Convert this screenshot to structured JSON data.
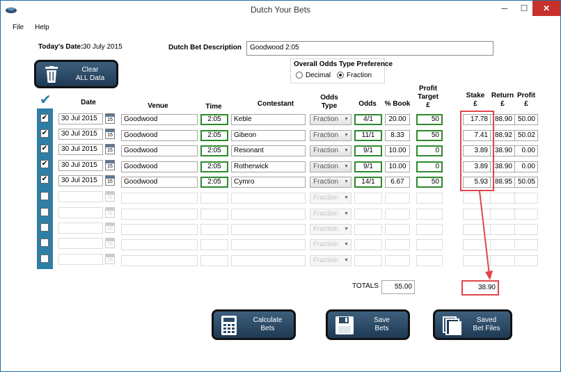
{
  "window": {
    "title": "Dutch Your Bets",
    "minimize": "─",
    "maximize": "☐",
    "close": "✕"
  },
  "menu": {
    "file": "File",
    "help": "Help"
  },
  "today": {
    "label": "Today's Date:",
    "value": "30 July 2015"
  },
  "description": {
    "label": "Dutch Bet Description",
    "value": "Goodwood 2:05"
  },
  "odds_pref": {
    "heading": "Overall Odds Type Preference",
    "decimal": "Decimal",
    "fraction": "Fraction",
    "selected": "Fraction"
  },
  "clear_button": {
    "line1": "Clear",
    "line2": "ALL Data"
  },
  "headers": {
    "date": "Date",
    "venue": "Venue",
    "time": "Time",
    "contestant": "Contestant",
    "odds_type_1": "Odds",
    "odds_type_2": "Type",
    "odds": "Odds",
    "book": "% Book",
    "profit_target_1": "Profit",
    "profit_target_2": "Target",
    "profit_target_3": "£",
    "stake_1": "Stake",
    "stake_2": "£",
    "return_1": "Return",
    "return_2": "£",
    "profit_1": "Profit",
    "profit_2": "£"
  },
  "rows": [
    {
      "checked": true,
      "date": "30 Jul 2015",
      "venue": "Goodwood",
      "time": "2:05",
      "contestant": "Keble",
      "odds_type": "Fraction",
      "odds": "4/1",
      "book": "20.00",
      "target": "50",
      "stake": "17.78",
      "return": "88.90",
      "profit": "50.00"
    },
    {
      "checked": true,
      "date": "30 Jul 2015",
      "venue": "Goodwood",
      "time": "2:05",
      "contestant": "Gibeon",
      "odds_type": "Fraction",
      "odds": "11/1",
      "book": "8.33",
      "target": "50",
      "stake": "7.41",
      "return": "88.92",
      "profit": "50.02"
    },
    {
      "checked": true,
      "date": "30 Jul 2015",
      "venue": "Goodwood",
      "time": "2:05",
      "contestant": "Resonant",
      "odds_type": "Fraction",
      "odds": "9/1",
      "book": "10.00",
      "target": "0",
      "stake": "3.89",
      "return": "38.90",
      "profit": "0.00"
    },
    {
      "checked": true,
      "date": "30 Jul 2015",
      "venue": "Goodwood",
      "time": "2:05",
      "contestant": "Rotherwick",
      "odds_type": "Fraction",
      "odds": "9/1",
      "book": "10.00",
      "target": "0",
      "stake": "3.89",
      "return": "38.90",
      "profit": "0.00"
    },
    {
      "checked": true,
      "date": "30 Jul 2015",
      "venue": "Goodwood",
      "time": "2:05",
      "contestant": "Cymro",
      "odds_type": "Fraction",
      "odds": "14/1",
      "book": "6.67",
      "target": "50",
      "stake": "5.93",
      "return": "88.95",
      "profit": "50.05"
    }
  ],
  "empty_row": {
    "odds_type": "Fraction",
    "cal_day": "15"
  },
  "checkmark_glyph": "✔",
  "totals": {
    "label": "TOTALS",
    "book": "55.00",
    "stake": "38.90"
  },
  "buttons": {
    "calculate": {
      "line1": "Calculate",
      "line2": "Bets"
    },
    "save": {
      "line1": "Save",
      "line2": "Bets"
    },
    "saved": {
      "line1": "Saved",
      "line2": "Bet Files"
    }
  },
  "colors": {
    "strip": "#2f7ea6",
    "highlight": "#e0454a",
    "field_border": "#2b8a2b"
  }
}
